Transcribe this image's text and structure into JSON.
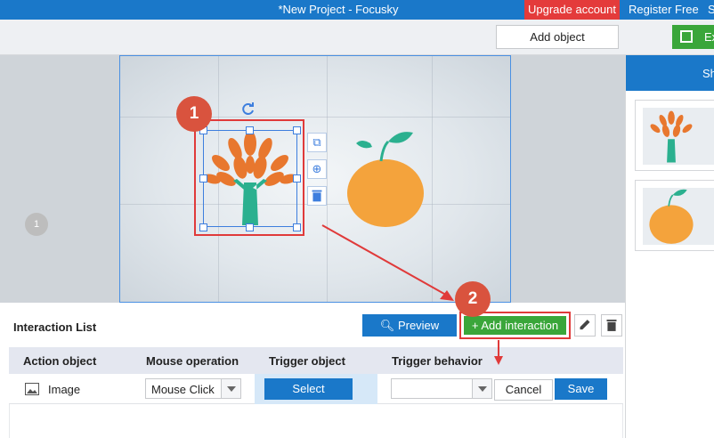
{
  "window": {
    "title": "*New Project - Focusky",
    "upgrade_label": "Upgrade account",
    "register_label": "Register Free",
    "cut_label": "S"
  },
  "toolbar": {
    "add_object_label": "Add object",
    "export_label": "Ex"
  },
  "canvas": {
    "page_number": "1"
  },
  "right_panel": {
    "header_label": "Sh",
    "thumbnails": [
      "tree-image",
      "orange-image"
    ]
  },
  "annotations": {
    "marker_1": "1",
    "marker_2": "2"
  },
  "interaction": {
    "title": "Interaction List",
    "preview_label": "Preview",
    "add_label": "+ Add interaction",
    "columns": [
      "Action object",
      "Mouse operation",
      "Trigger object",
      "Trigger behavior"
    ],
    "row": {
      "action_object": "Image",
      "mouse_operation": "Mouse Click",
      "trigger_object_button": "Select",
      "trigger_behavior": "",
      "cancel_label": "Cancel",
      "save_label": "Save"
    }
  },
  "colors": {
    "brand_blue": "#1a78c9",
    "upgrade_red": "#e43b3b",
    "add_green": "#3aa63a",
    "annotation_red": "#e03a3a",
    "marker_red": "#d9533e",
    "tree_orange": "#e8772e",
    "tree_trunk": "#2bb08f",
    "orange_fruit": "#f4a33c"
  },
  "icons": {
    "preview": "search-icon",
    "edit": "pencil-icon",
    "delete": "trash-icon",
    "rotate": "rotate-icon",
    "image": "image-icon"
  }
}
